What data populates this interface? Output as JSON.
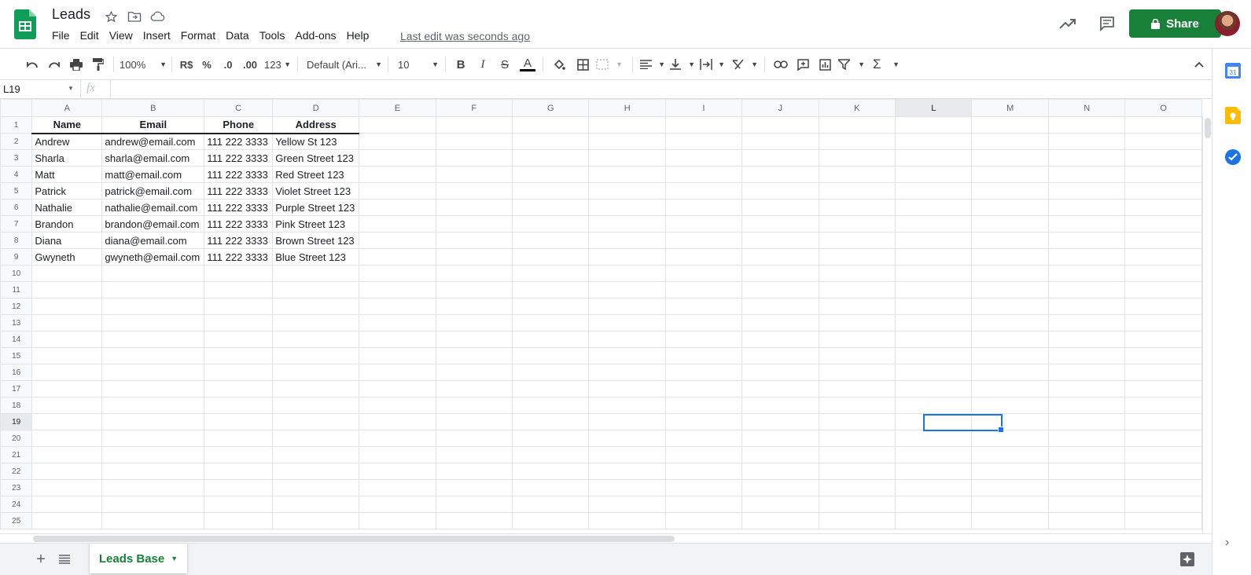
{
  "doc": {
    "title": "Leads",
    "last_edit": "Last edit was seconds ago"
  },
  "menu": [
    "File",
    "Edit",
    "View",
    "Insert",
    "Format",
    "Data",
    "Tools",
    "Add-ons",
    "Help"
  ],
  "share_label": "Share",
  "toolbar": {
    "zoom": "100%",
    "currency": "R$",
    "percent": "%",
    "dec_less": ".0",
    "dec_more": ".00",
    "more_formats": "123",
    "font": "Default (Ari...",
    "font_size": "10"
  },
  "formula_bar": {
    "name_box": "L19",
    "fx": "fx"
  },
  "columns": [
    "A",
    "B",
    "C",
    "D",
    "E",
    "F",
    "G",
    "H",
    "I",
    "J",
    "K",
    "L",
    "M",
    "N",
    "O"
  ],
  "selected_column": "L",
  "selected_row": 19,
  "header_row": [
    "Name",
    "Email",
    "Phone",
    "Address"
  ],
  "rows": [
    [
      "Andrew",
      "andrew@email.com",
      "111 222 3333",
      "Yellow St 123"
    ],
    [
      "Sharla",
      "sharla@email.com",
      "111 222 3333",
      "Green Street 123"
    ],
    [
      "Matt",
      "matt@email.com",
      "111 222 3333",
      "Red Street 123"
    ],
    [
      "Patrick",
      "patrick@email.com",
      "111 222 3333",
      "Violet Street 123"
    ],
    [
      "Nathalie",
      "nathalie@email.com",
      "111 222 3333",
      "Purple Street 123"
    ],
    [
      "Brandon",
      "brandon@email.com",
      "111 222 3333",
      "Pink Street 123"
    ],
    [
      "Diana",
      "diana@email.com",
      "111 222 3333",
      "Brown Street 123"
    ],
    [
      "Gwyneth",
      "gwyneth@email.com",
      "111 222 3333",
      "Blue Street 123"
    ]
  ],
  "row_numbers": [
    1,
    2,
    3,
    4,
    5,
    6,
    7,
    8,
    9,
    10,
    11,
    12,
    13,
    14,
    15,
    16,
    17,
    18,
    19,
    20,
    21,
    22,
    23,
    24,
    25
  ],
  "sheet_tab": "Leads Base",
  "colors": {
    "brand_green": "#188038",
    "selection_blue": "#1a73e8"
  }
}
